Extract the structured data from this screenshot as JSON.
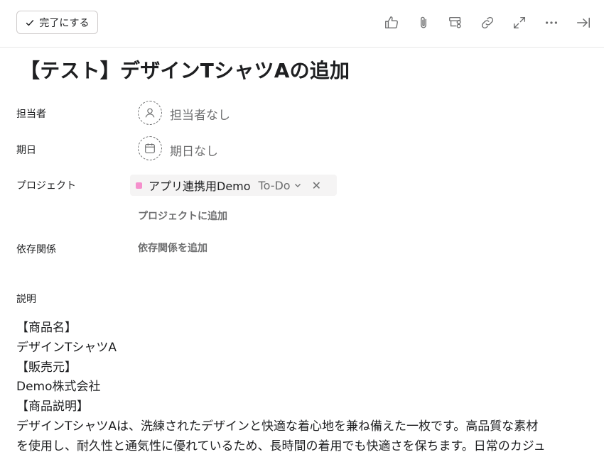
{
  "toolbar": {
    "complete_label": "完了にする",
    "icons": [
      "thumbs-up-icon",
      "attachment-icon",
      "subtask-icon",
      "link-icon",
      "expand-icon",
      "more-icon",
      "close-panel-icon"
    ]
  },
  "task": {
    "title": "【テスト】デザインTシャツAの追加"
  },
  "fields": {
    "assignee_label": "担当者",
    "assignee_value": "担当者なし",
    "due_label": "期日",
    "due_value": "期日なし",
    "project_label": "プロジェクト",
    "project_name": "アプリ連携用Demo",
    "project_section": "To-Do",
    "project_color": "#f590cd",
    "add_project": "プロジェクトに追加",
    "dependency_label": "依存関係",
    "add_dependency": "依存関係を追加",
    "description_label": "説明"
  },
  "description": {
    "lines": [
      "【商品名】",
      "デザインTシャツA",
      "【販売元】",
      "Demo株式会社",
      "【商品説明】",
      "デザインTシャツAは、洗練されたデザインと快適な着心地を兼ね備えた一枚です。高品質な素材",
      "を使用し、耐久性と通気性に優れているため、長時間の着用でも快適さを保ちます。日常のカジュ"
    ]
  }
}
